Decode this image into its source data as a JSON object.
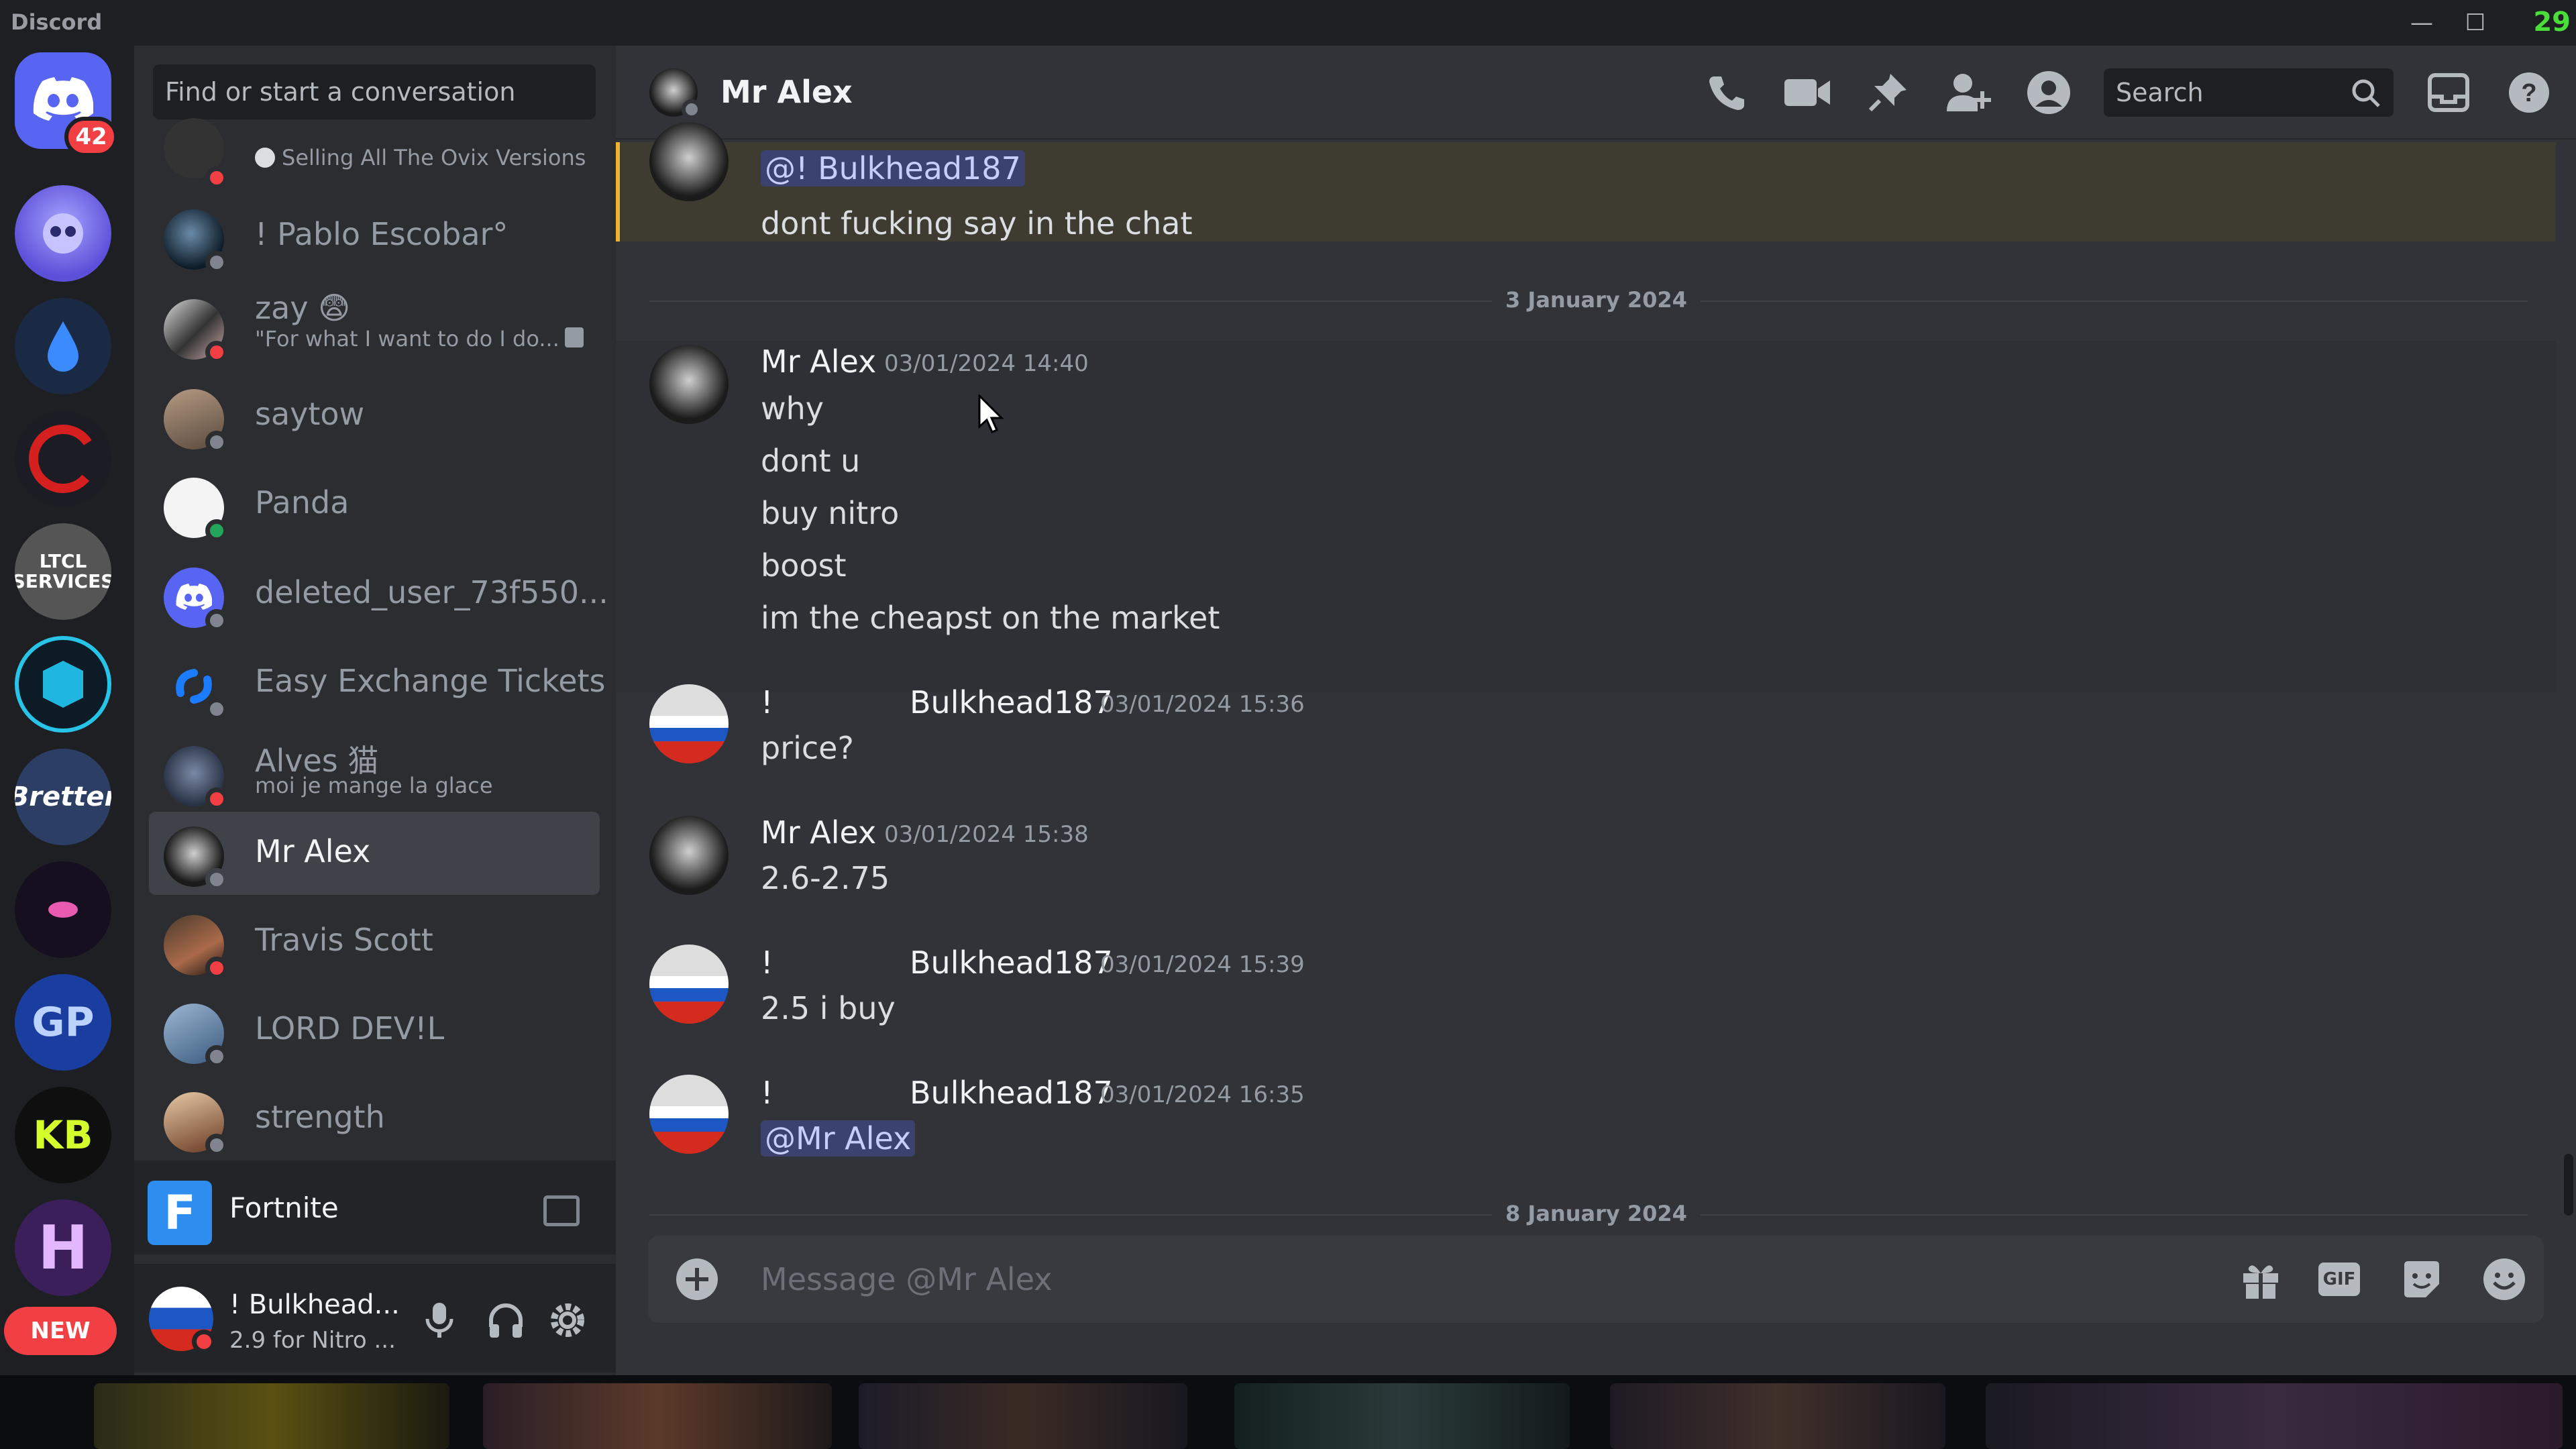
{
  "app": {
    "title": "Discord",
    "fps": "29"
  },
  "servers": {
    "home_badge": "42",
    "new_label": "NEW",
    "ltcl_text": "LTCL SERVICES",
    "bretter_text": "Bretter",
    "gp_text": "GP",
    "kb_text": "KB",
    "h_text": "H"
  },
  "dm": {
    "search_placeholder": "Find or start a conversation",
    "items": [
      {
        "name": "",
        "sub": "Selling All The Ovix Versions"
      },
      {
        "name": "! Pablo Escobar°"
      },
      {
        "name": "zay 😨",
        "sub": "\"For what I want to do I do..."
      },
      {
        "name": "saytow"
      },
      {
        "name": "Panda"
      },
      {
        "name": "deleted_user_73f550..."
      },
      {
        "name": "Easy Exchange Tickets"
      },
      {
        "name": "Alves 猫",
        "sub": "moi je mange la glace"
      },
      {
        "name": "Mr Alex"
      },
      {
        "name": "Travis Scott"
      },
      {
        "name": "LORD DEV!L"
      },
      {
        "name": "strength"
      }
    ],
    "game": "Fortnite",
    "user": {
      "name": "! Bulkhead...",
      "status": "2.9 for Nitro ..."
    }
  },
  "chat": {
    "title": "Mr Alex",
    "search_placeholder": "Search",
    "composer_placeholder": "Message @Mr Alex",
    "gif_label": "GIF",
    "top": {
      "mention": "@!          Bulkhead187",
      "line": "dont fucking say in the chat"
    },
    "date1": "3 January 2024",
    "date2": "8 January 2024",
    "messages": [
      {
        "author": "Mr Alex",
        "time": "03/01/2024 14:40",
        "lines": [
          "why",
          "dont u",
          "buy nitro",
          "boost",
          "im the cheapst on the market"
        ]
      },
      {
        "author_prefix": "!",
        "author": "Bulkhead187",
        "time": "03/01/2024 15:36",
        "lines": [
          "price?"
        ]
      },
      {
        "author": "Mr Alex",
        "time": "03/01/2024 15:38",
        "lines": [
          "2.6-2.75"
        ]
      },
      {
        "author_prefix": "!",
        "author": "Bulkhead187",
        "time": "03/01/2024 15:39",
        "lines": [
          "2.5 i buy"
        ]
      },
      {
        "author_prefix": "!",
        "author": "Bulkhead187",
        "time": "03/01/2024 16:35",
        "lines": [
          "@Mr Alex"
        ]
      }
    ]
  },
  "colors": {
    "blurple": "#5865f2",
    "online": "#23a55a",
    "dnd": "#f23f43",
    "idle_gray": "#80848e"
  }
}
